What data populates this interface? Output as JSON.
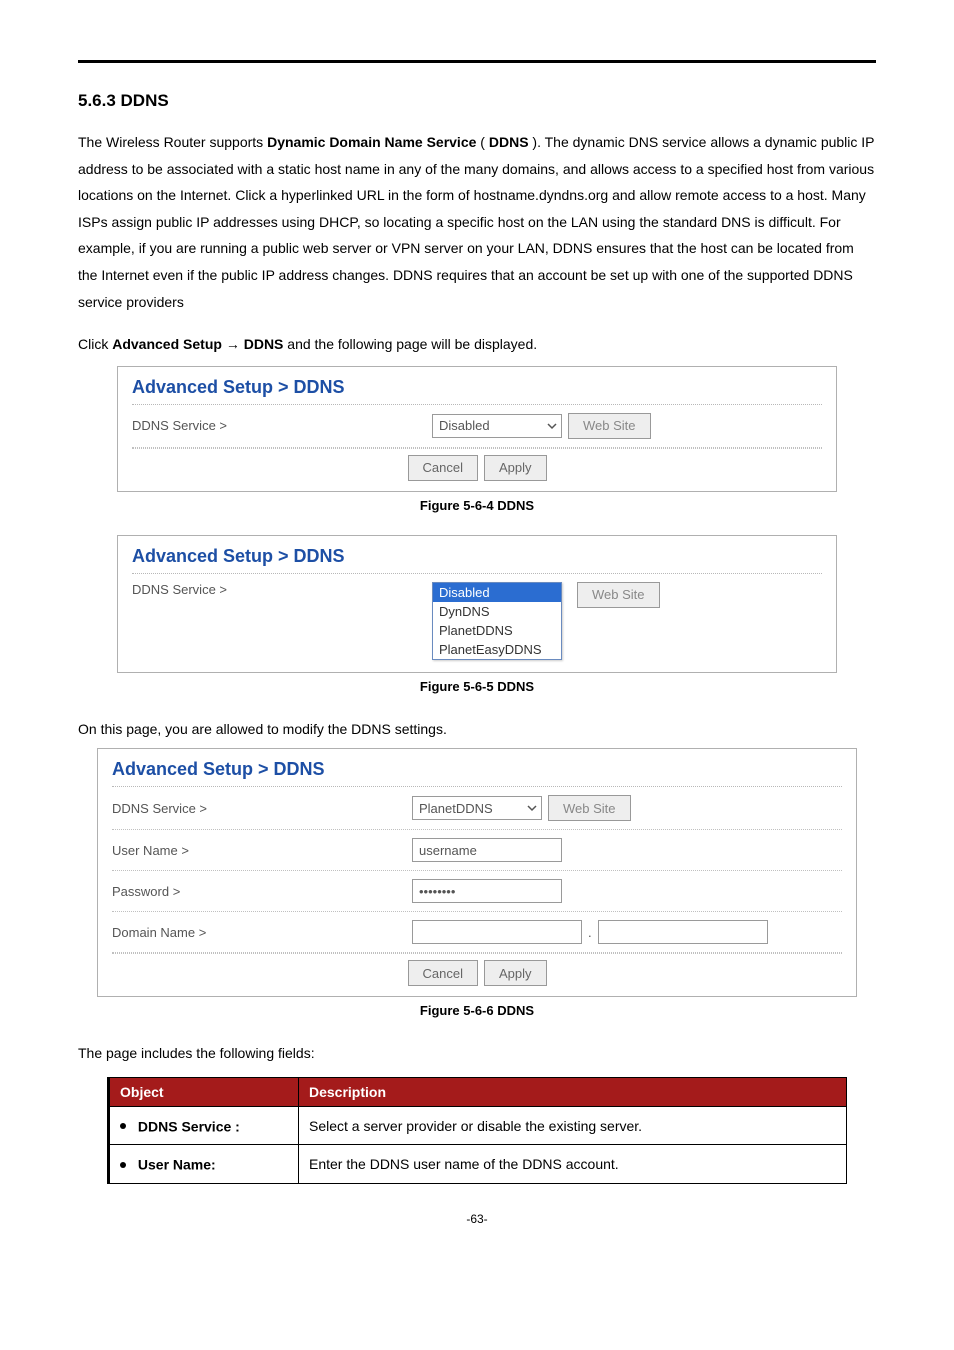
{
  "section_heading": "5.6.3  DDNS",
  "intro_paragraph_parts": {
    "p1a": "The Wireless Router supports ",
    "p1b": "Dynamic Domain Name Service",
    "p1c": " (",
    "p1d": "DDNS",
    "p1e": "). The dynamic DNS service allows a dynamic public IP address to be associated with a static host name in any of the many domains, and allows access to a specified host from various locations on the Internet. Click a hyperlinked URL in the form of hostname.dyndns.org and allow remote access to a host. Many ISPs assign public IP addresses using DHCP, so locating a specific host on the LAN using the standard DNS is difficult. For example, if you are running a public web server or VPN server on your LAN, DDNS ensures that the host can be located from the Internet even if the public IP address changes. DDNS requires that an account be set up with one of the supported DDNS service providers"
  },
  "nav_line": {
    "a": "Click ",
    "b": "Advanced Setup",
    "arrow": " → ",
    "c": "DDNS",
    "d": " and the following page will be displayed."
  },
  "figure4": {
    "title": "Advanced Setup > DDNS",
    "row_label": "DDNS Service >",
    "select_value": "Disabled",
    "website_btn": "Web Site",
    "cancel_btn": "Cancel",
    "apply_btn": "Apply",
    "caption": "Figure 5-6-4 DDNS"
  },
  "figure5": {
    "title": "Advanced Setup > DDNS",
    "row_label": "DDNS Service >",
    "options": [
      "Disabled",
      "DynDNS",
      "PlanetDDNS",
      "PlanetEasyDDNS"
    ],
    "website_btn": "Web Site",
    "caption": "Figure 5-6-5 DDNS"
  },
  "modify_line": "On this page, you are allowed to modify the DDNS settings.",
  "figure6": {
    "title": "Advanced Setup > DDNS",
    "rows": {
      "service_label": "DDNS Service >",
      "service_value": "PlanetDDNS",
      "website_btn": "Web Site",
      "user_label": "User Name >",
      "user_value": "username",
      "pass_label": "Password >",
      "pass_value": "••••••••",
      "domain_label": "Domain Name >",
      "domain_sep": ".",
      "cancel_btn": "Cancel",
      "apply_btn": "Apply"
    },
    "caption": "Figure 5-6-6 DDNS"
  },
  "fields_intro": "The page includes the following fields:",
  "fields_table": {
    "headers": {
      "object": "Object",
      "description": "Description"
    },
    "rows": [
      {
        "object": "DDNS Service :",
        "description": "Select a server provider or disable the existing server."
      },
      {
        "object": "User Name:",
        "description": "Enter the DDNS user name of the DDNS account."
      }
    ]
  },
  "page_number": "-63-"
}
